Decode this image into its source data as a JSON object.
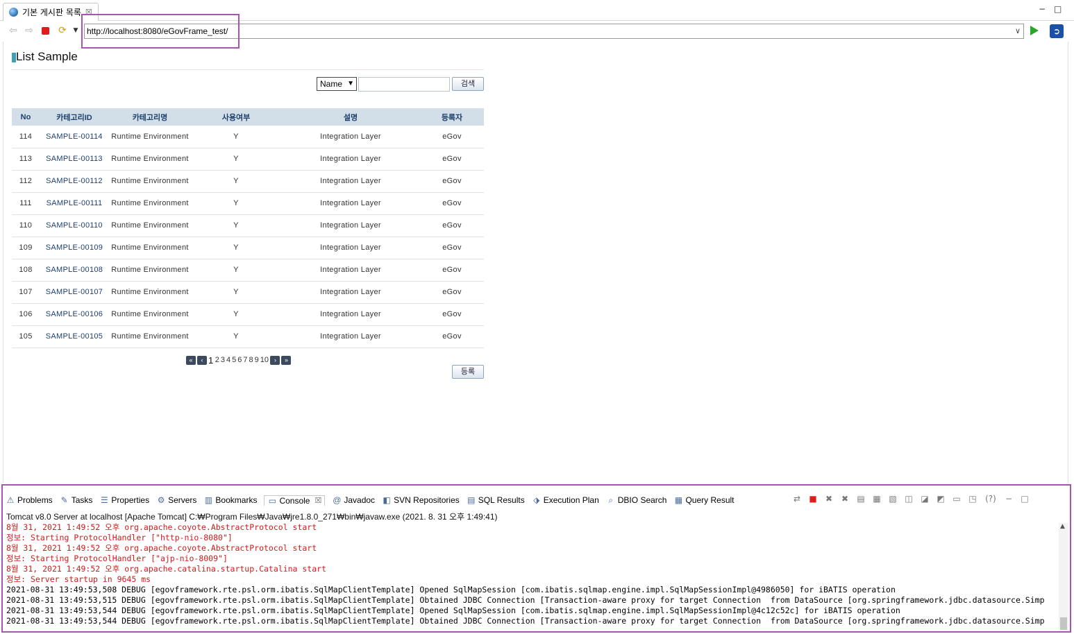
{
  "editor_tab": {
    "title": "기본 게시판 목록",
    "close": "☒"
  },
  "browser": {
    "url": "http://localhost:8080/eGovFrame_test/",
    "minimize": "−",
    "maximize": "□"
  },
  "page": {
    "title": "List Sample",
    "search": {
      "select_value": "Name",
      "button": "검색"
    },
    "register_button": "등록",
    "table": {
      "headers": [
        "No",
        "카테고리ID",
        "카테고리명",
        "사용여부",
        "설명",
        "등록자"
      ],
      "rows": [
        [
          "114",
          "SAMPLE-00114",
          "Runtime Environment",
          "Y",
          "Integration Layer",
          "eGov"
        ],
        [
          "113",
          "SAMPLE-00113",
          "Runtime Environment",
          "Y",
          "Integration Layer",
          "eGov"
        ],
        [
          "112",
          "SAMPLE-00112",
          "Runtime Environment",
          "Y",
          "Integration Layer",
          "eGov"
        ],
        [
          "111",
          "SAMPLE-00111",
          "Runtime Environment",
          "Y",
          "Integration Layer",
          "eGov"
        ],
        [
          "110",
          "SAMPLE-00110",
          "Runtime Environment",
          "Y",
          "Integration Layer",
          "eGov"
        ],
        [
          "109",
          "SAMPLE-00109",
          "Runtime Environment",
          "Y",
          "Integration Layer",
          "eGov"
        ],
        [
          "108",
          "SAMPLE-00108",
          "Runtime Environment",
          "Y",
          "Integration Layer",
          "eGov"
        ],
        [
          "107",
          "SAMPLE-00107",
          "Runtime Environment",
          "Y",
          "Integration Layer",
          "eGov"
        ],
        [
          "106",
          "SAMPLE-00106",
          "Runtime Environment",
          "Y",
          "Integration Layer",
          "eGov"
        ],
        [
          "105",
          "SAMPLE-00105",
          "Runtime Environment",
          "Y",
          "Integration Layer",
          "eGov"
        ]
      ]
    },
    "pagination": {
      "first": "«",
      "prev": "‹",
      "next": "›",
      "last": "»",
      "current": "1",
      "pages": [
        "2",
        "3",
        "4",
        "5",
        "6",
        "7",
        "8",
        "9",
        "10"
      ]
    }
  },
  "panel": {
    "views": [
      {
        "name": "problems",
        "label": "Problems",
        "icon": "problems-icon",
        "glyph": "⚠"
      },
      {
        "name": "tasks",
        "label": "Tasks",
        "icon": "tasks-icon",
        "glyph": "✎"
      },
      {
        "name": "properties",
        "label": "Properties",
        "icon": "properties-icon",
        "glyph": "☰"
      },
      {
        "name": "servers",
        "label": "Servers",
        "icon": "servers-icon",
        "glyph": "⚙"
      },
      {
        "name": "bookmarks",
        "label": "Bookmarks",
        "icon": "bookmarks-icon",
        "glyph": "▥"
      },
      {
        "name": "console",
        "label": "Console",
        "icon": "console-icon",
        "glyph": "▭",
        "active": true
      },
      {
        "name": "javadoc",
        "label": "Javadoc",
        "icon": "javadoc-icon",
        "glyph": "@"
      },
      {
        "name": "svn-repositories",
        "label": "SVN Repositories",
        "icon": "svn-icon",
        "glyph": "◧"
      },
      {
        "name": "sql-results",
        "label": "SQL Results",
        "icon": "sql-results-icon",
        "glyph": "▤"
      },
      {
        "name": "execution-plan",
        "label": "Execution Plan",
        "icon": "execution-plan-icon",
        "glyph": "⬗"
      },
      {
        "name": "dbio-search",
        "label": "DBIO Search",
        "icon": "dbio-search-icon",
        "glyph": "⌕"
      },
      {
        "name": "query-result",
        "label": "Query Result",
        "icon": "query-result-icon",
        "glyph": "▦"
      }
    ],
    "console_close": "☒",
    "help": "(?)",
    "console_title": "Tomcat v8.0 Server at localhost [Apache Tomcat] C:₩Program Files₩Java₩jre1.8.0_271₩bin₩javaw.exe  (2021. 8. 31 오후 1:49:41)",
    "lines": [
      {
        "type": "err",
        "text": "8월 31, 2021 1:49:52 오후 org.apache.coyote.AbstractProtocol start"
      },
      {
        "type": "err",
        "text": "정보: Starting ProtocolHandler [\"http-nio-8080\"]"
      },
      {
        "type": "err",
        "text": "8월 31, 2021 1:49:52 오후 org.apache.coyote.AbstractProtocol start"
      },
      {
        "type": "err",
        "text": "정보: Starting ProtocolHandler [\"ajp-nio-8009\"]"
      },
      {
        "type": "err",
        "text": "8월 31, 2021 1:49:52 오후 org.apache.catalina.startup.Catalina start"
      },
      {
        "type": "err",
        "text": "정보: Server startup in 9645 ms"
      },
      {
        "type": "out",
        "text": "2021-08-31 13:49:53,508 DEBUG [egovframework.rte.psl.orm.ibatis.SqlMapClientTemplate] Opened SqlMapSession [com.ibatis.sqlmap.engine.impl.SqlMapSessionImpl@4986050] for iBATIS operation"
      },
      {
        "type": "out",
        "text": "2021-08-31 13:49:53,515 DEBUG [egovframework.rte.psl.orm.ibatis.SqlMapClientTemplate] Obtained JDBC Connection [Transaction-aware proxy for target Connection  from DataSource [org.springframework.jdbc.datasource.Simp"
      },
      {
        "type": "out",
        "text": "2021-08-31 13:49:53,544 DEBUG [egovframework.rte.psl.orm.ibatis.SqlMapClientTemplate] Opened SqlMapSession [com.ibatis.sqlmap.engine.impl.SqlMapSessionImpl@4c12c52c] for iBATIS operation"
      },
      {
        "type": "out",
        "text": "2021-08-31 13:49:53,544 DEBUG [egovframework.rte.psl.orm.ibatis.SqlMapClientTemplate] Obtained JDBC Connection [Transaction-aware proxy for target Connection  from DataSource [org.springframework.jdbc.datasource.Simp"
      }
    ]
  },
  "colors": {
    "highlight": "#a554b1",
    "table_header_bg": "#d3dfe8",
    "console_error": "#d11a1a",
    "link": "#1c3e73"
  }
}
